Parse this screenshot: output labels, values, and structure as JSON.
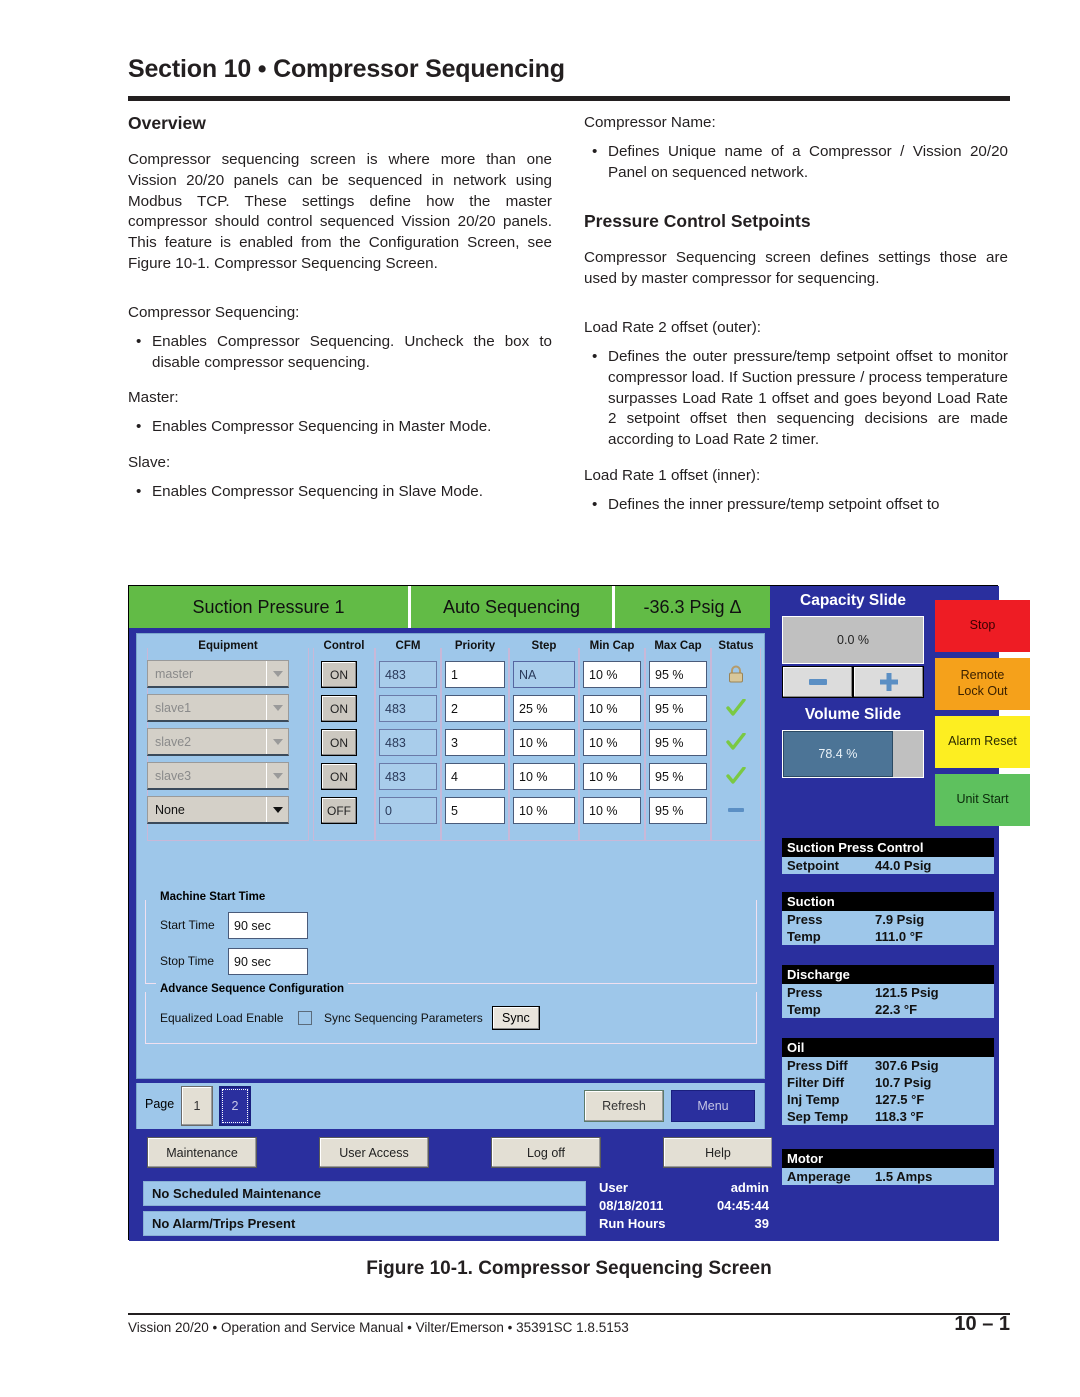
{
  "doc": {
    "section_title": "Section 10 • Compressor Sequencing",
    "caption": "Figure 10-1. Compressor Sequencing Screen",
    "footer_left": "Vission 20/20 • Operation and Service Manual • Vilter/Emerson • 35391SC 1.8.5153",
    "footer_page": "10  –  1"
  },
  "left_column": {
    "heading": "Overview",
    "intro": "Compressor sequencing screen is where more than one Vission 20/20 panels can be sequenced in network using Modbus TCP. These settings define how the master compressor should control sequenced Vission 20/20 panels. This feature is enabled from the Configuration Screen, see Figure 10-1. Compressor Sequencing Screen.",
    "terms": [
      {
        "term": "Compressor Sequencing:",
        "bullets": [
          "Enables Compressor Sequencing. Uncheck the box to disable compressor sequencing."
        ]
      },
      {
        "term": "Master:",
        "bullets": [
          "Enables Compressor Sequencing in Master Mode."
        ]
      },
      {
        "term": "Slave:",
        "bullets": [
          "Enables Compressor Sequencing in Slave Mode."
        ]
      }
    ]
  },
  "right_column": {
    "term_top": "Compressor Name:",
    "bullet_top": "Defines Unique name of a Compressor / Vission 20/20 Panel on sequenced network.",
    "heading": "Pressure Control Setpoints",
    "intro": "Compressor Sequencing screen defines settings those are used by master compressor for sequencing.",
    "terms": [
      {
        "term": "Load Rate 2 offset (outer):",
        "bullets": [
          "Defines the outer pressure/temp setpoint offset to monitor compressor load. If Suction pressure / process temperature surpasses Load Rate 1 offset and goes beyond Load Rate 2 setpoint offset then sequencing decisions are made according to Load Rate 2 timer."
        ]
      },
      {
        "term": "Load Rate 1 offset (inner):",
        "bullets": [
          "Defines the inner pressure/temp setpoint offset to"
        ]
      }
    ]
  },
  "screenshot": {
    "top_bar": {
      "left": "Suction Pressure 1",
      "mode": "Auto Sequencing",
      "delta": "-36.3 Psig Δ",
      "color": "#62bb46"
    },
    "table": {
      "headers": [
        "Equipment",
        "Control",
        "CFM",
        "Priority",
        "Step",
        "Min Cap",
        "Max Cap",
        "Status"
      ],
      "rows": [
        {
          "equipment": "master",
          "equipment_enabled": false,
          "control": "ON",
          "cfm": "483",
          "cfm_readonly": true,
          "priority": "1",
          "step": "NA",
          "step_readonly": true,
          "min_cap": "10 %",
          "max_cap": "95 %",
          "status": "lock-icon"
        },
        {
          "equipment": "slave1",
          "equipment_enabled": false,
          "control": "ON",
          "cfm": "483",
          "cfm_readonly": true,
          "priority": "2",
          "step": "25 %",
          "step_readonly": false,
          "min_cap": "10 %",
          "max_cap": "95 %",
          "status": "check-icon"
        },
        {
          "equipment": "slave2",
          "equipment_enabled": false,
          "control": "ON",
          "cfm": "483",
          "cfm_readonly": true,
          "priority": "3",
          "step": "10 %",
          "step_readonly": false,
          "min_cap": "10 %",
          "max_cap": "95 %",
          "status": "check-icon"
        },
        {
          "equipment": "slave3",
          "equipment_enabled": false,
          "control": "ON",
          "cfm": "483",
          "cfm_readonly": true,
          "priority": "4",
          "step": "10 %",
          "step_readonly": false,
          "min_cap": "10 %",
          "max_cap": "95 %",
          "status": "check-icon"
        },
        {
          "equipment": "None",
          "equipment_enabled": true,
          "control": "OFF",
          "cfm": "0",
          "cfm_readonly": true,
          "priority": "5",
          "step": "10 %",
          "step_readonly": false,
          "min_cap": "10 %",
          "max_cap": "95 %",
          "status": "dash-icon"
        }
      ]
    },
    "machine_start_time": {
      "legend": "Machine Start Time",
      "start_label": "Start Time",
      "start_value": "90 sec",
      "stop_label": "Stop Time",
      "stop_value": "90 sec"
    },
    "advance_sequence": {
      "legend": "Advance Sequence Configuration",
      "equalized_label": "Equalized Load Enable",
      "equalized_checked": false,
      "sync_label": "Sync Sequencing Parameters",
      "sync_button": "Sync"
    },
    "pager": {
      "label": "Page",
      "pages": [
        "1",
        "2"
      ],
      "active": "2",
      "refresh": "Refresh",
      "menu": "Menu"
    },
    "nav_buttons": [
      "Maintenance",
      "User Access",
      "Log off",
      "Help"
    ],
    "status_bars": [
      "No Scheduled Maintenance",
      "No Alarm/Trips Present"
    ],
    "user_info": {
      "user_label": "User",
      "user_value": "admin",
      "date": "08/18/2011",
      "time": "04:45:44",
      "run_hours_label": "Run Hours",
      "run_hours_value": "39"
    },
    "capacity_slide": {
      "label": "Capacity Slide",
      "value": "0.0 %",
      "minus": "–",
      "plus": "+"
    },
    "volume_slide": {
      "label": "Volume Slide",
      "value": "78.4 %",
      "percent": 78.4
    },
    "action_buttons": [
      {
        "label": "Stop",
        "bg": "#ee1c24",
        "fg": "#3a0000"
      },
      {
        "label": "Remote\nLock Out",
        "bg": "#f5a11b",
        "fg": "#3a2000"
      },
      {
        "label": "Alarm Reset",
        "bg": "#fdee21",
        "fg": "#2a2a00"
      },
      {
        "label": "Unit Start",
        "bg": "#5ec15e",
        "fg": "#0a2a0a"
      }
    ],
    "readouts": [
      {
        "header": "Suction Press Control",
        "rows": [
          [
            "Setpoint",
            "44.0 Psig"
          ]
        ]
      },
      {
        "header": "Suction",
        "rows": [
          [
            "Press",
            "7.9 Psig"
          ],
          [
            "Temp",
            "111.0 °F"
          ]
        ]
      },
      {
        "header": "Discharge",
        "rows": [
          [
            "Press",
            "121.5 Psig"
          ],
          [
            "Temp",
            "22.3 °F"
          ]
        ]
      },
      {
        "header": "Oil",
        "rows": [
          [
            "Press Diff",
            "307.6 Psig"
          ],
          [
            "Filter Diff",
            "10.7 Psig"
          ],
          [
            "Inj Temp",
            "127.5 °F"
          ],
          [
            "Sep Temp",
            "118.3 °F"
          ]
        ]
      },
      {
        "header": "Motor",
        "rows": [
          [
            "Amperage",
            "1.5 Amps"
          ]
        ]
      }
    ]
  }
}
